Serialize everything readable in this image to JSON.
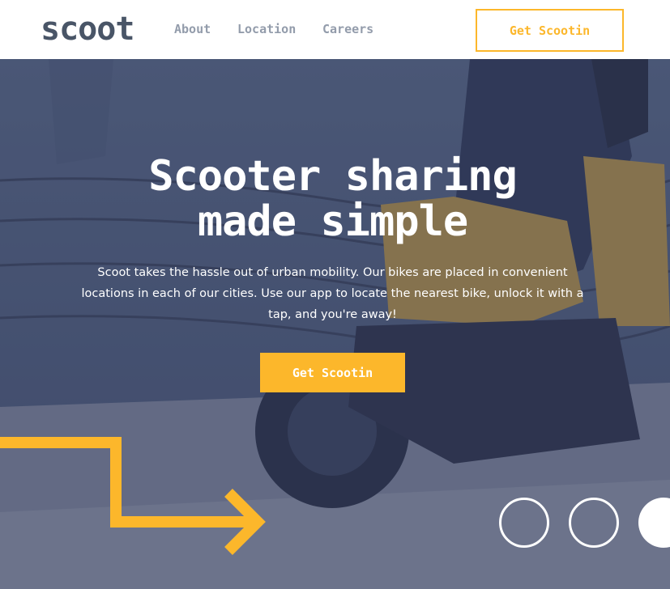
{
  "brand": {
    "logo_text": "scoot"
  },
  "nav": {
    "items": [
      {
        "label": "About"
      },
      {
        "label": "Location"
      },
      {
        "label": "Careers"
      }
    ],
    "cta_label": "Get Scootin"
  },
  "hero": {
    "title_line1": "Scooter sharing",
    "title_line2": "made simple",
    "description": "Scoot takes the hassle out of urban mobility. Our bikes are placed in convenient locations in each of our cities. Use our app to locate the nearest bike, unlock it with a tap, and you're away!",
    "cta_label": "Get Scootin",
    "background_image": "scooter-rider-photo"
  },
  "decor": {
    "arrow_icon": "right-arrow-line-icon",
    "ring_icons": [
      "circle-outline-icon",
      "circle-outline-icon",
      "circle-filled-icon"
    ]
  },
  "colors": {
    "accent": "#fcb72b",
    "logo": "#495567",
    "nav_text": "#939cab",
    "hero_overlay": "#333a58",
    "white": "#ffffff"
  }
}
